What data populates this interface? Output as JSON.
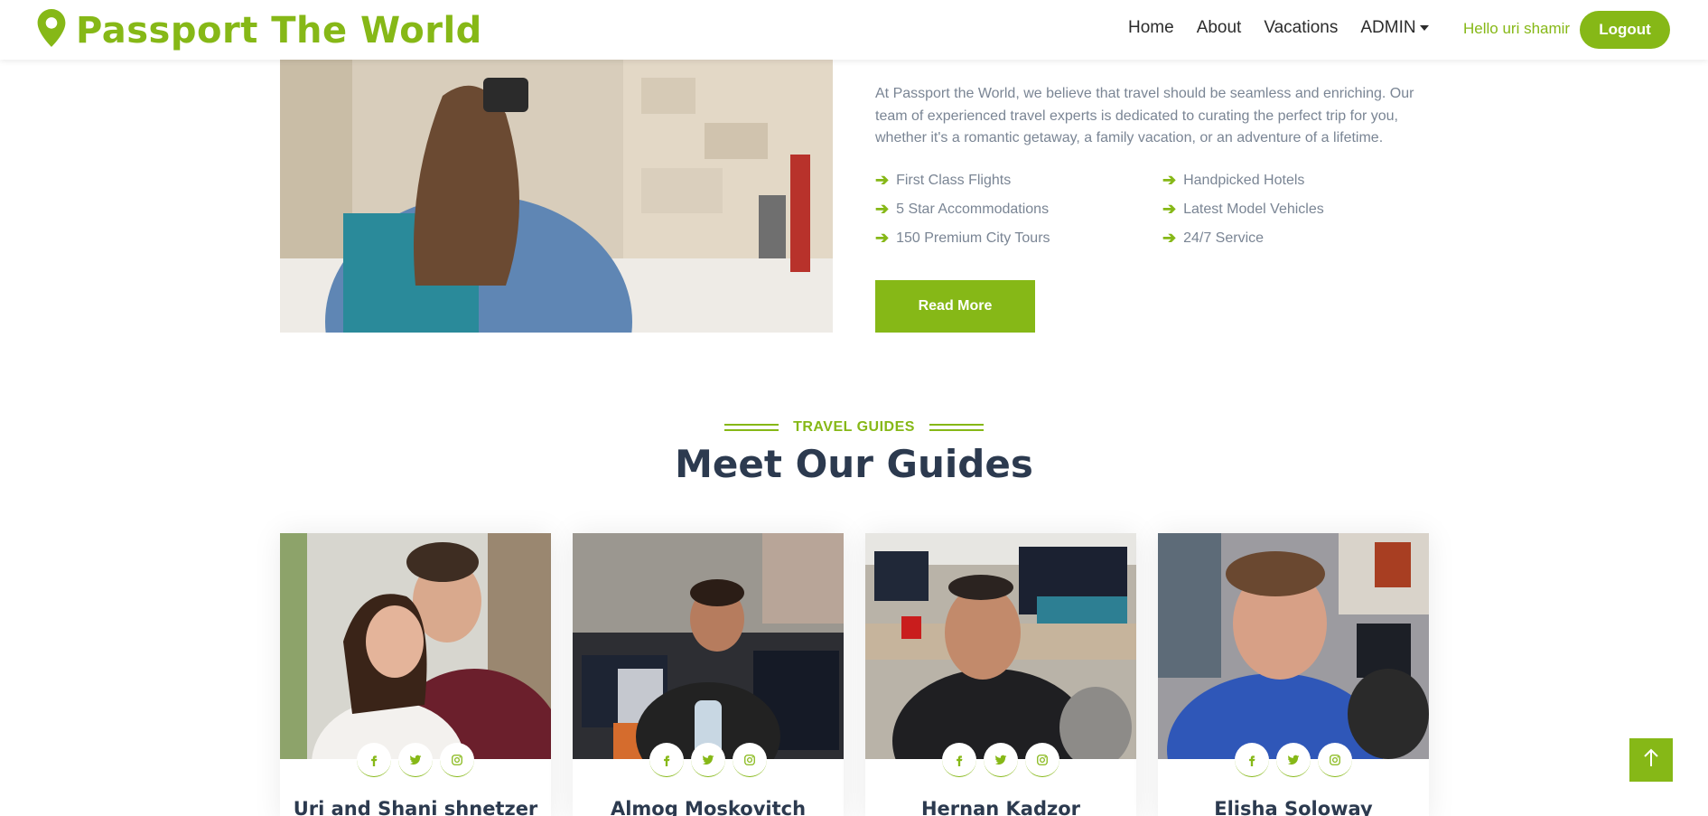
{
  "brand": {
    "name": "Passport The World",
    "icon": "map-pin-icon"
  },
  "nav": {
    "links": [
      "Home",
      "About",
      "Vacations"
    ],
    "admin": "ADMIN",
    "greeting": "Hello uri shamir",
    "logout": "Logout"
  },
  "about": {
    "paragraph": "At Passport the World, we believe that travel should be seamless and enriching. Our team of experienced travel experts is dedicated to curating the perfect trip for you, whether it's a romantic getaway, a family vacation, or an adventure of a lifetime.",
    "features": [
      "First Class Flights",
      "Handpicked Hotels",
      "5 Star Accommodations",
      "Latest Model Vehicles",
      "150 Premium City Tours",
      "24/7 Service"
    ],
    "read_more": "Read More"
  },
  "guides": {
    "label": "TRAVEL GUIDES",
    "title": "Meet Our Guides",
    "people": [
      {
        "name": "Uri and Shani shnetzer"
      },
      {
        "name": "Almog Moskovitch"
      },
      {
        "name": "Hernan Kadzor"
      },
      {
        "name": "Elisha Soloway"
      }
    ],
    "social_icons": [
      "facebook-icon",
      "twitter-icon",
      "instagram-icon"
    ]
  },
  "colors": {
    "accent": "#86b817",
    "heading": "#2c3a4f",
    "body": "#7a8594"
  }
}
